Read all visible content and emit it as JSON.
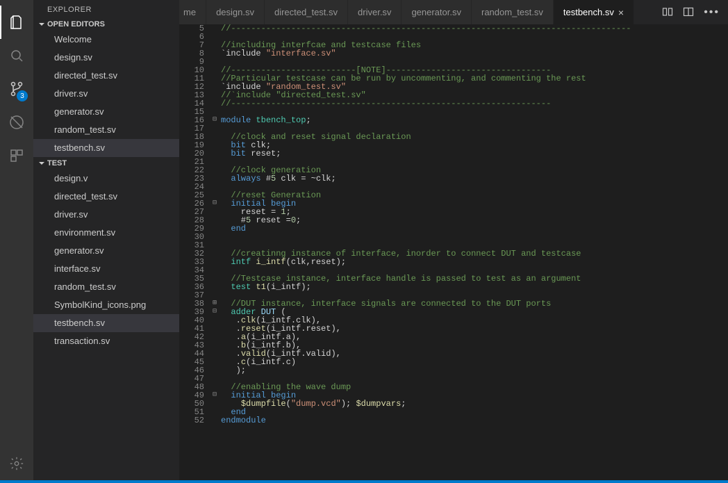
{
  "sidebar": {
    "title": "EXPLORER",
    "sections": {
      "open_editors": {
        "label": "OPEN EDITORS",
        "items": [
          {
            "label": "Welcome",
            "active": false
          },
          {
            "label": "design.sv",
            "active": false
          },
          {
            "label": "directed_test.sv",
            "active": false
          },
          {
            "label": "driver.sv",
            "active": false
          },
          {
            "label": "generator.sv",
            "active": false
          },
          {
            "label": "random_test.sv",
            "active": false
          },
          {
            "label": "testbench.sv",
            "active": true
          }
        ]
      },
      "test": {
        "label": "TEST",
        "items": [
          {
            "label": "design.v",
            "active": false
          },
          {
            "label": "directed_test.sv",
            "active": false
          },
          {
            "label": "driver.sv",
            "active": false
          },
          {
            "label": "environment.sv",
            "active": false
          },
          {
            "label": "generator.sv",
            "active": false
          },
          {
            "label": "interface.sv",
            "active": false
          },
          {
            "label": "random_test.sv",
            "active": false
          },
          {
            "label": "SymbolKind_icons.png",
            "active": false
          },
          {
            "label": "testbench.sv",
            "active": true
          },
          {
            "label": "transaction.sv",
            "active": false
          }
        ]
      }
    }
  },
  "activity_badge": "3",
  "tabs": {
    "items": [
      {
        "label": "me",
        "partial": true,
        "active": false,
        "close": false
      },
      {
        "label": "design.sv",
        "active": false,
        "close": false
      },
      {
        "label": "directed_test.sv",
        "active": false,
        "close": false
      },
      {
        "label": "driver.sv",
        "active": false,
        "close": false
      },
      {
        "label": "generator.sv",
        "active": false,
        "close": false
      },
      {
        "label": "random_test.sv",
        "active": false,
        "close": false
      },
      {
        "label": "testbench.sv",
        "active": true,
        "close": true
      }
    ]
  },
  "editor": {
    "first_line_no": 5,
    "fold_markers": {
      "16": "−",
      "26": "−",
      "38": "+",
      "39": "−",
      "49": "−"
    },
    "lines": [
      {
        "n": 5,
        "t": [
          [
            "comment",
            "//--------------------------------------------------------------------------------"
          ]
        ]
      },
      {
        "n": 6,
        "t": []
      },
      {
        "n": 7,
        "t": [
          [
            "comment",
            "//including interfcae and testcase files"
          ]
        ]
      },
      {
        "n": 8,
        "t": [
          [
            "op",
            "`include "
          ],
          [
            "string",
            "\"interface.sv\""
          ]
        ]
      },
      {
        "n": 9,
        "t": []
      },
      {
        "n": 10,
        "t": [
          [
            "comment",
            "//-------------------------[NOTE]---------------------------------"
          ]
        ]
      },
      {
        "n": 11,
        "t": [
          [
            "comment",
            "//Particular testcase can be run by uncommenting, and commenting the rest"
          ]
        ]
      },
      {
        "n": 12,
        "t": [
          [
            "op",
            "`include "
          ],
          [
            "string",
            "\"random_test.sv\""
          ]
        ]
      },
      {
        "n": 13,
        "t": [
          [
            "comment",
            "//`include \"directed_test.sv\""
          ]
        ]
      },
      {
        "n": 14,
        "t": [
          [
            "comment",
            "//----------------------------------------------------------------"
          ]
        ]
      },
      {
        "n": 15,
        "t": []
      },
      {
        "n": 16,
        "t": [
          [
            "keyword",
            "module"
          ],
          [
            "op",
            " "
          ],
          [
            "type",
            "tbench_top"
          ],
          [
            "op",
            ";"
          ]
        ]
      },
      {
        "n": 17,
        "t": []
      },
      {
        "n": 18,
        "t": [
          [
            "op",
            "  "
          ],
          [
            "comment",
            "//clock and reset signal declaration"
          ]
        ]
      },
      {
        "n": 19,
        "t": [
          [
            "op",
            "  "
          ],
          [
            "keyword",
            "bit"
          ],
          [
            "op",
            " clk;"
          ]
        ]
      },
      {
        "n": 20,
        "t": [
          [
            "op",
            "  "
          ],
          [
            "keyword",
            "bit"
          ],
          [
            "op",
            " reset;"
          ]
        ]
      },
      {
        "n": 21,
        "t": []
      },
      {
        "n": 22,
        "t": [
          [
            "op",
            "  "
          ],
          [
            "comment",
            "//clock generation"
          ]
        ]
      },
      {
        "n": 23,
        "t": [
          [
            "op",
            "  "
          ],
          [
            "keyword",
            "always"
          ],
          [
            "op",
            " #"
          ],
          [
            "num",
            "5"
          ],
          [
            "op",
            " clk = ~clk;"
          ]
        ]
      },
      {
        "n": 24,
        "t": []
      },
      {
        "n": 25,
        "t": [
          [
            "op",
            "  "
          ],
          [
            "comment",
            "//reset Generation"
          ]
        ]
      },
      {
        "n": 26,
        "t": [
          [
            "op",
            "  "
          ],
          [
            "keyword",
            "initial"
          ],
          [
            "op",
            " "
          ],
          [
            "keyword",
            "begin"
          ]
        ]
      },
      {
        "n": 27,
        "t": [
          [
            "op",
            "    reset = "
          ],
          [
            "num",
            "1"
          ],
          [
            "op",
            ";"
          ]
        ]
      },
      {
        "n": 28,
        "t": [
          [
            "op",
            "    #"
          ],
          [
            "num",
            "5"
          ],
          [
            "op",
            " reset ="
          ],
          [
            "num",
            "0"
          ],
          [
            "op",
            ";"
          ]
        ]
      },
      {
        "n": 29,
        "t": [
          [
            "op",
            "  "
          ],
          [
            "keyword",
            "end"
          ]
        ]
      },
      {
        "n": 30,
        "t": []
      },
      {
        "n": 31,
        "t": []
      },
      {
        "n": 32,
        "t": [
          [
            "op",
            "  "
          ],
          [
            "comment",
            "//creatinng instance of interface, inorder to connect DUT and testcase"
          ]
        ]
      },
      {
        "n": 33,
        "t": [
          [
            "op",
            "  "
          ],
          [
            "type",
            "intf"
          ],
          [
            "op",
            " "
          ],
          [
            "func",
            "i_intf"
          ],
          [
            "op",
            "(clk,reset);"
          ]
        ]
      },
      {
        "n": 34,
        "t": []
      },
      {
        "n": 35,
        "t": [
          [
            "op",
            "  "
          ],
          [
            "comment",
            "//Testcase instance, interface handle is passed to test as an argument"
          ]
        ]
      },
      {
        "n": 36,
        "t": [
          [
            "op",
            "  "
          ],
          [
            "type",
            "test"
          ],
          [
            "op",
            " "
          ],
          [
            "func",
            "t1"
          ],
          [
            "op",
            "(i_intf);"
          ]
        ]
      },
      {
        "n": 37,
        "t": []
      },
      {
        "n": 38,
        "t": [
          [
            "op",
            "  "
          ],
          [
            "comment",
            "//DUT instance, interface signals are connected to the DUT ports"
          ]
        ]
      },
      {
        "n": 39,
        "t": [
          [
            "op",
            "  "
          ],
          [
            "type",
            "adder"
          ],
          [
            "op",
            " "
          ],
          [
            "ident",
            "DUT"
          ],
          [
            "op",
            " ("
          ]
        ]
      },
      {
        "n": 40,
        "t": [
          [
            "op",
            "   ."
          ],
          [
            "func",
            "clk"
          ],
          [
            "op",
            "(i_intf.clk),"
          ]
        ]
      },
      {
        "n": 41,
        "t": [
          [
            "op",
            "   ."
          ],
          [
            "func",
            "reset"
          ],
          [
            "op",
            "(i_intf.reset),"
          ]
        ]
      },
      {
        "n": 42,
        "t": [
          [
            "op",
            "   ."
          ],
          [
            "func",
            "a"
          ],
          [
            "op",
            "(i_intf.a),"
          ]
        ]
      },
      {
        "n": 43,
        "t": [
          [
            "op",
            "   ."
          ],
          [
            "func",
            "b"
          ],
          [
            "op",
            "(i_intf.b),"
          ]
        ]
      },
      {
        "n": 44,
        "t": [
          [
            "op",
            "   ."
          ],
          [
            "func",
            "valid"
          ],
          [
            "op",
            "(i_intf.valid),"
          ]
        ]
      },
      {
        "n": 45,
        "t": [
          [
            "op",
            "   ."
          ],
          [
            "func",
            "c"
          ],
          [
            "op",
            "(i_intf.c)"
          ]
        ]
      },
      {
        "n": 46,
        "t": [
          [
            "op",
            "   );"
          ]
        ]
      },
      {
        "n": 47,
        "t": []
      },
      {
        "n": 48,
        "t": [
          [
            "op",
            "  "
          ],
          [
            "comment",
            "//enabling the wave dump"
          ]
        ]
      },
      {
        "n": 49,
        "t": [
          [
            "op",
            "  "
          ],
          [
            "keyword",
            "initial"
          ],
          [
            "op",
            " "
          ],
          [
            "keyword",
            "begin"
          ]
        ]
      },
      {
        "n": 50,
        "t": [
          [
            "op",
            "    "
          ],
          [
            "func",
            "$dumpfile"
          ],
          [
            "op",
            "("
          ],
          [
            "string",
            "\"dump.vcd\""
          ],
          [
            "op",
            "); "
          ],
          [
            "func",
            "$dumpvars"
          ],
          [
            "op",
            ";"
          ]
        ]
      },
      {
        "n": 51,
        "t": [
          [
            "op",
            "  "
          ],
          [
            "keyword",
            "end"
          ]
        ]
      },
      {
        "n": 52,
        "t": [
          [
            "keyword",
            "endmodule"
          ]
        ]
      }
    ]
  }
}
